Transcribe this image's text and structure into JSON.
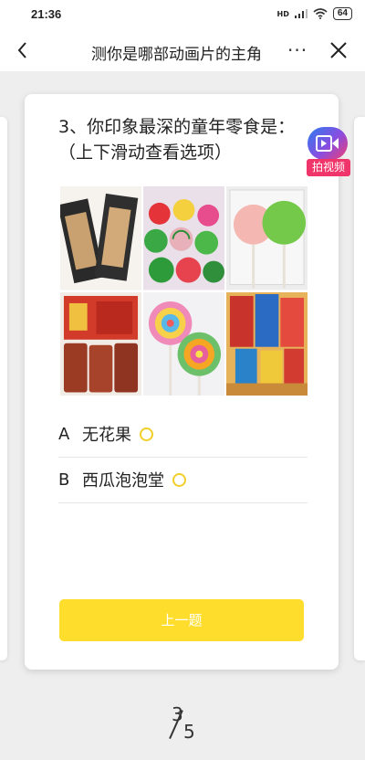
{
  "status_bar": {
    "time": "21:36",
    "network": "HD",
    "battery": "64"
  },
  "nav": {
    "title": "测你是哪部动画片的主角",
    "more": "···"
  },
  "question": {
    "line1": "3、你印象最深的童年零食是：",
    "line2": "（上下滑动查看选项）",
    "image_tiles": [
      "dried-plum-packs",
      "watermelon-gum-balls",
      "clear-lollipops",
      "spicy-strips",
      "rainbow-swirl-lollipops",
      "snack-packets"
    ]
  },
  "options": [
    {
      "letter": "A",
      "text": "无花果"
    },
    {
      "letter": "B",
      "text": "西瓜泡泡堂"
    }
  ],
  "prev_button": "上一题",
  "float_video": {
    "label": "拍视频"
  },
  "pager": {
    "current": "3",
    "total": "5"
  },
  "colors": {
    "accent": "#fedd2c",
    "radio": "#f2cf28",
    "video_label": "#f0356a"
  }
}
